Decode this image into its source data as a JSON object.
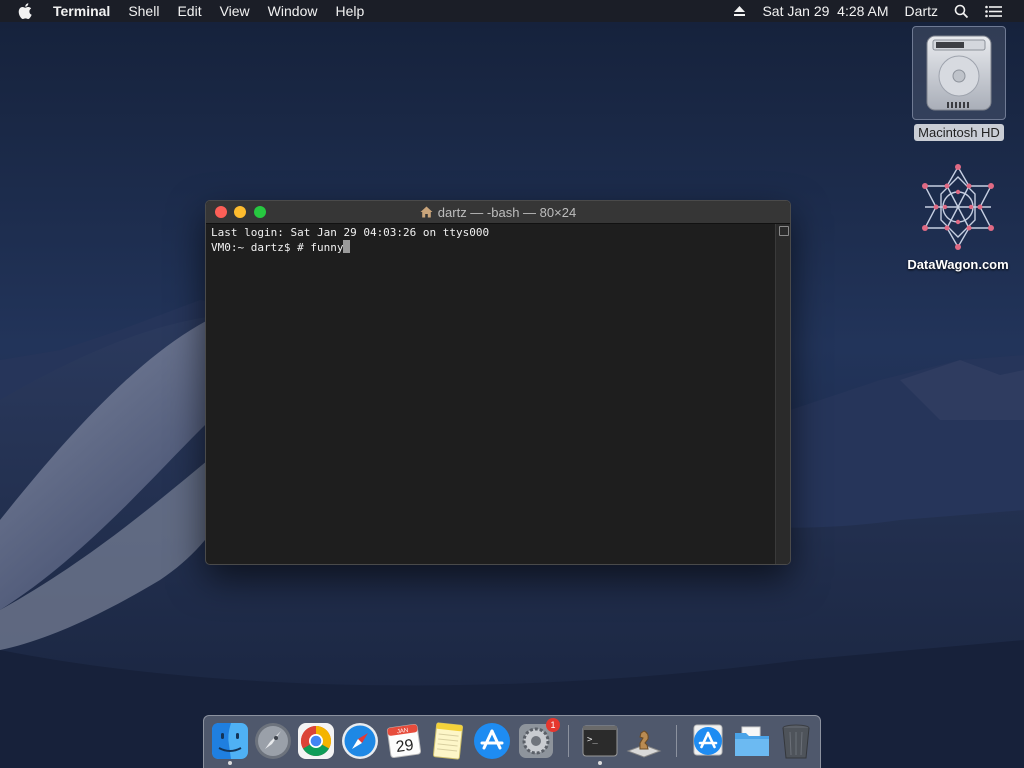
{
  "menubar": {
    "apple_icon": "apple-icon",
    "app_name": "Terminal",
    "menus": [
      "Shell",
      "Edit",
      "View",
      "Window",
      "Help"
    ],
    "eject_icon": "eject-icon",
    "clock": "Sat Jan 29  4:28 AM",
    "user": "Dartz",
    "search_icon": "spotlight-search-icon",
    "list_icon": "notification-center-icon"
  },
  "desktop": {
    "icons": [
      {
        "label": "Macintosh HD",
        "icon": "hard-drive-icon",
        "selected": true
      },
      {
        "label": "DataWagon.com",
        "icon": "datawagon-logo-icon",
        "selected": false
      }
    ]
  },
  "terminal": {
    "title": "dartz — -bash — 80×24",
    "lines": [
      "Last login: Sat Jan 29 04:03:26 on ttys000",
      "VM0:~ dartz$ # funny"
    ]
  },
  "dock": {
    "items": [
      {
        "name": "finder",
        "running": true
      },
      {
        "name": "launchpad",
        "running": false
      },
      {
        "name": "chrome",
        "running": false
      },
      {
        "name": "safari",
        "running": false
      },
      {
        "name": "calendar",
        "running": false,
        "month": "JAN",
        "day": "29"
      },
      {
        "name": "notes",
        "running": false
      },
      {
        "name": "app-store",
        "running": false
      },
      {
        "name": "system-preferences",
        "running": false,
        "badge": "1"
      },
      {
        "name": "terminal",
        "running": true
      },
      {
        "name": "chess",
        "running": false
      },
      {
        "name": "app-store-downloads",
        "running": false
      },
      {
        "name": "documents-folder",
        "running": false
      },
      {
        "name": "trash",
        "running": false
      }
    ]
  },
  "colors": {
    "menubar_bg": "#1c1e24",
    "terminal_bg": "#1e1e1e",
    "close": "#fd5f57",
    "minimize": "#febc2e",
    "zoom": "#27c840"
  }
}
